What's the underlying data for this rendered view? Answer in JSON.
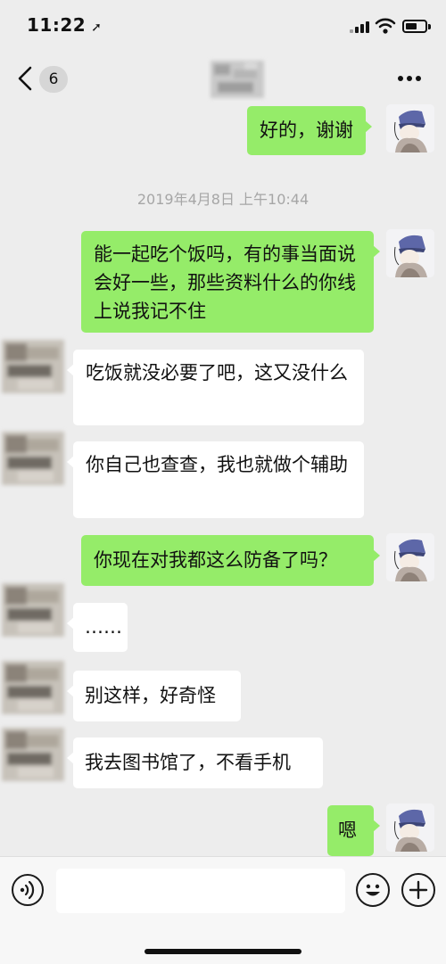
{
  "status_bar": {
    "time": "11:22",
    "location_icon": "location-arrow-icon"
  },
  "nav": {
    "back_icon": "chevron-left-icon",
    "unread_count": "6",
    "more_icon": "more-dots-icon"
  },
  "messages": [
    {
      "side": "me",
      "text": "好的，谢谢"
    },
    {
      "type": "timestamp",
      "text": "2019年4月8日 上午10:44"
    },
    {
      "side": "me",
      "text": "能一起吃个饭吗，有的事当面说会好一些，那些资料什么的你线上说我记不住"
    },
    {
      "side": "other",
      "text": "吃饭就没必要了吧，这又没什么"
    },
    {
      "side": "other",
      "text": "你自己也查查，我也就做个辅助"
    },
    {
      "side": "me",
      "text": "你现在对我都这么防备了吗？"
    },
    {
      "side": "other",
      "text": "……"
    },
    {
      "side": "other",
      "text": "别这样，好奇怪"
    },
    {
      "side": "other",
      "text": "我去图书馆了，不看手机"
    },
    {
      "side": "me",
      "text": "嗯"
    }
  ],
  "input_bar": {
    "value": "",
    "voice_icon": "voice-icon",
    "emoji_icon": "emoji-icon",
    "plus_icon": "plus-icon"
  },
  "colors": {
    "background": "#ededed",
    "my_bubble": "#95ec69",
    "their_bubble": "#ffffff"
  }
}
